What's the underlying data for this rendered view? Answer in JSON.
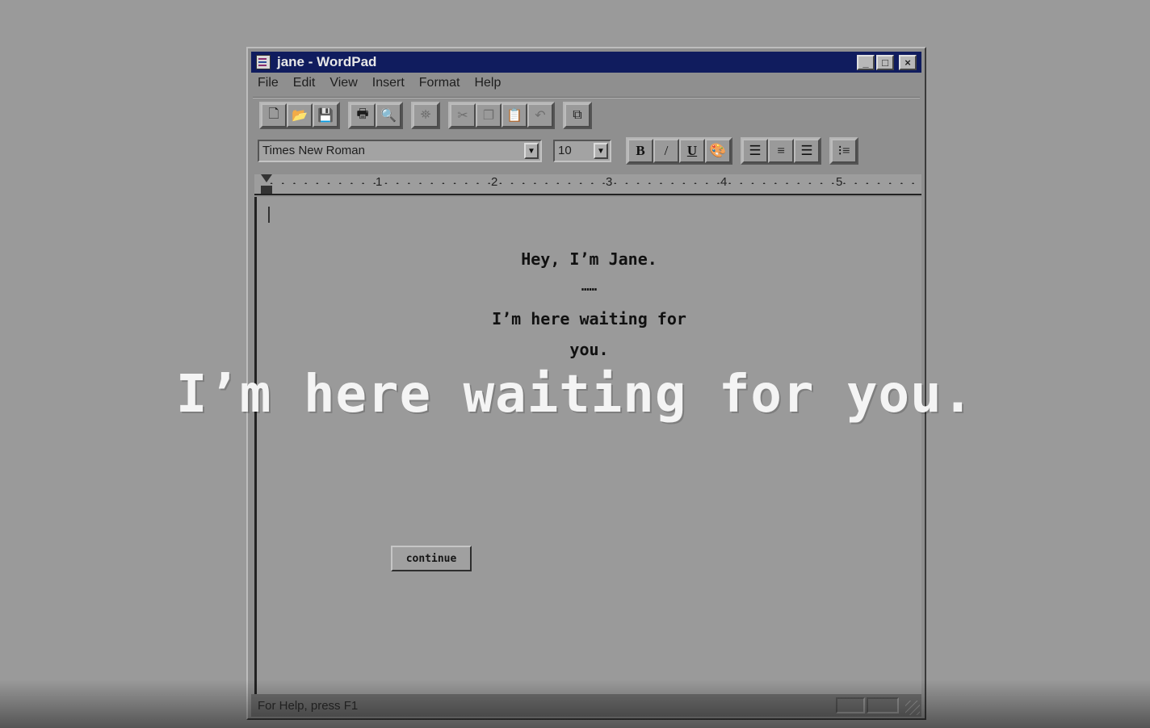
{
  "window": {
    "title": "jane - WordPad",
    "controls": {
      "minimize": "_",
      "maximize": "□",
      "close": "×"
    }
  },
  "menu": [
    "File",
    "Edit",
    "View",
    "Insert",
    "Format",
    "Help"
  ],
  "toolbar": {
    "groups": [
      [
        "new-icon",
        "open-icon",
        "save-icon"
      ],
      [
        "print-icon",
        "print-preview-icon"
      ],
      [
        "find-icon"
      ],
      [
        "cut-icon",
        "copy-icon",
        "paste-icon",
        "undo-icon"
      ],
      [
        "insert-object-icon"
      ]
    ]
  },
  "format": {
    "font": "Times New Roman",
    "size": "10",
    "bold": "B",
    "italic": "/",
    "underline": "U"
  },
  "ruler": {
    "marks": [
      "1",
      "2",
      "3",
      "4",
      "5"
    ]
  },
  "document": {
    "line1": "Hey, I’m Jane.",
    "line2": "……",
    "line3": "I’m here waiting for",
    "line4": "you."
  },
  "continue_button": "continue",
  "status": {
    "message": "For Help, press F1"
  },
  "overlay": {
    "caption": "I’m here waiting for you."
  },
  "colors": {
    "titlebar": "#101c5e",
    "background": "#9a9a9a",
    "caption": "#f4f4f4"
  }
}
